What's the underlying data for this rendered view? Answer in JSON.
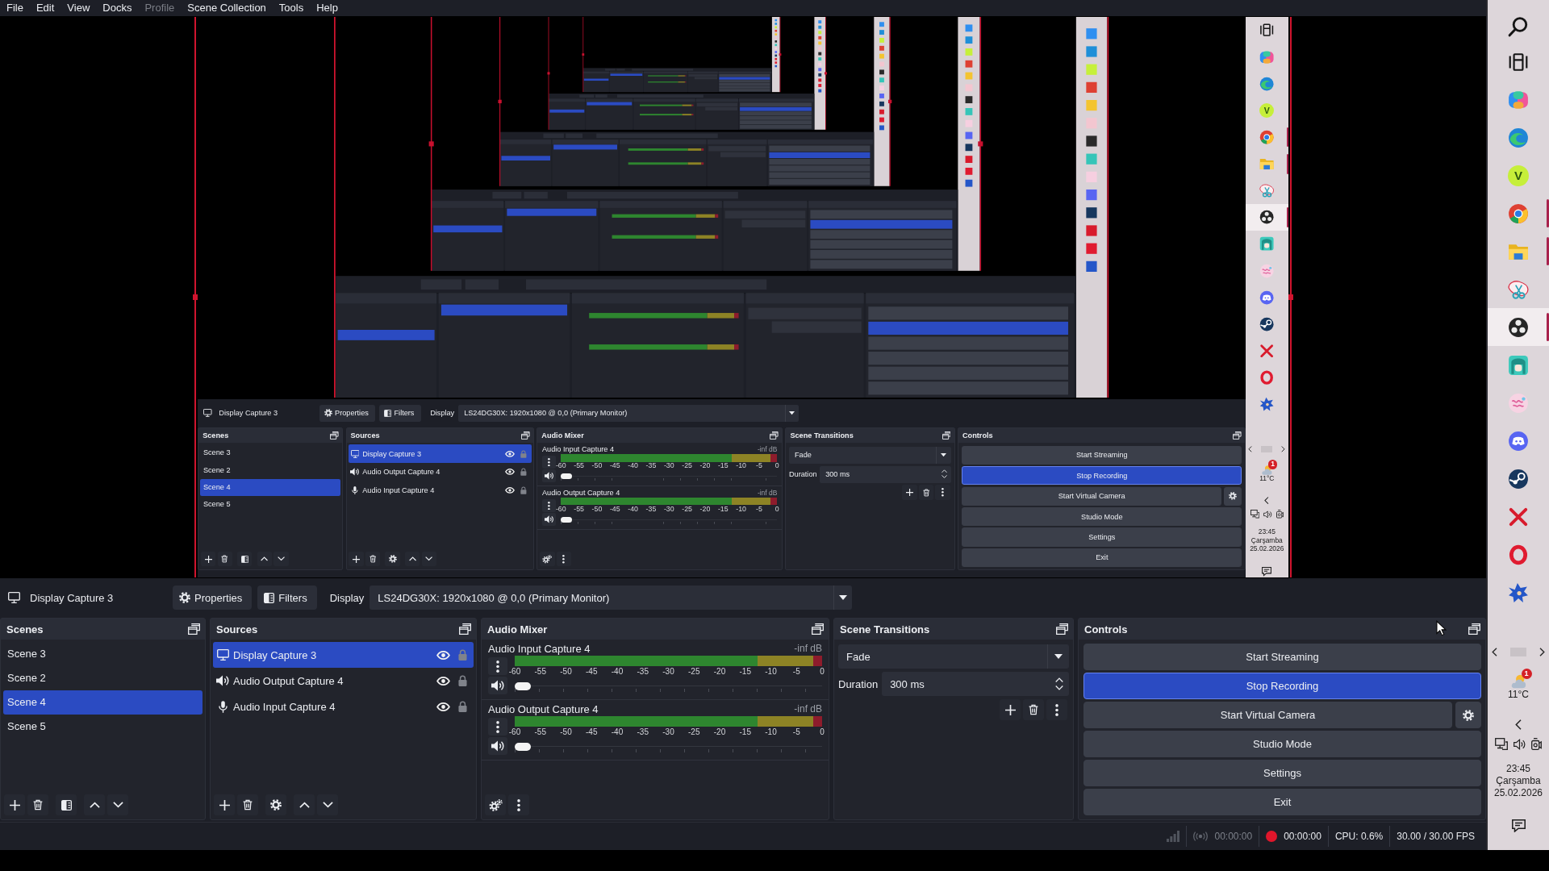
{
  "menu_bar": [
    {
      "label": "File",
      "disabled": false
    },
    {
      "label": "Edit",
      "disabled": false
    },
    {
      "label": "View",
      "disabled": false
    },
    {
      "label": "Docks",
      "disabled": false
    },
    {
      "label": "Profile",
      "disabled": true
    },
    {
      "label": "Scene Collection",
      "disabled": false
    },
    {
      "label": "Tools",
      "disabled": false
    },
    {
      "label": "Help",
      "disabled": false
    }
  ],
  "preview": {
    "capture": {
      "source_bar": {
        "source_name": "Display Capture 3",
        "properties": "Properties",
        "filters": "Filters",
        "display_label": "Display",
        "display_value": "LS24DG30X: 1920x1080 @ 0,0 (Primary Monitor)"
      },
      "docks": {
        "scenes": {
          "title": "Scenes",
          "items": [
            {
              "label": "Scene 3",
              "selected": false
            },
            {
              "label": "Scene 2",
              "selected": false
            },
            {
              "label": "Scene 4",
              "selected": true
            },
            {
              "label": "Scene 5",
              "selected": false
            }
          ]
        },
        "sources": {
          "title": "Sources",
          "items": [
            {
              "label": "Display Capture 3",
              "kind": "display",
              "selected": true,
              "visible": true,
              "locked": false
            },
            {
              "label": "Audio Output Capture 4",
              "kind": "speaker",
              "selected": false,
              "visible": true,
              "locked": false
            },
            {
              "label": "Audio Input Capture 4",
              "kind": "microphone",
              "selected": false,
              "visible": true,
              "locked": false
            }
          ]
        },
        "audio_mixer": {
          "title": "Audio Mixer",
          "channels": [
            {
              "name": "Audio Input Capture 4",
              "reading": "-inf dB",
              "muted": false,
              "volume": {
                "level": 0
              },
              "scale": [
                "-60",
                "-55",
                "-50",
                "-45",
                "-40",
                "-35",
                "-30",
                "-25",
                "-20",
                "-15",
                "-10",
                "-5",
                "0"
              ]
            },
            {
              "name": "Audio Output Capture 4",
              "reading": "-inf dB",
              "muted": false,
              "volume": {
                "level": 0
              },
              "scale": [
                "-60",
                "-55",
                "-50",
                "-45",
                "-40",
                "-35",
                "-30",
                "-25",
                "-20",
                "-15",
                "-10",
                "-5",
                "0"
              ]
            }
          ]
        },
        "scene_transitions": {
          "title": "Scene Transitions",
          "transition": "Fade",
          "duration_label": "Duration",
          "duration": "300 ms"
        },
        "controls": {
          "title": "Controls",
          "buttons": [
            {
              "label": "Start Streaming",
              "kind": "plain",
              "checked": false
            },
            {
              "label": "Stop Recording",
              "kind": "plain",
              "checked": true
            },
            {
              "label": "Start Virtual Camera",
              "kind": "split",
              "checked": false
            },
            {
              "label": "Studio Mode",
              "kind": "plain",
              "checked": false
            },
            {
              "label": "Settings",
              "kind": "plain",
              "checked": false
            },
            {
              "label": "Exit",
              "kind": "plain",
              "checked": false
            }
          ]
        }
      },
      "taskbar": {
        "apps": [
          {
            "kind": "taskview",
            "running": false,
            "selected": false
          },
          {
            "kind": "swirl",
            "running": false,
            "selected": false
          },
          {
            "kind": "wave",
            "running": false,
            "selected": false
          },
          {
            "kind": "letter",
            "glyph": "V",
            "running": false,
            "selected": false
          },
          {
            "kind": "wheel",
            "running": true,
            "selected": false
          },
          {
            "kind": "folder",
            "running": true,
            "selected": false
          },
          {
            "kind": "scissors",
            "running": false,
            "selected": false
          },
          {
            "kind": "reel",
            "running": true,
            "selected": true
          },
          {
            "kind": "character",
            "running": false,
            "selected": false
          },
          {
            "kind": "sticker",
            "running": false,
            "selected": false
          },
          {
            "kind": "controller",
            "running": false,
            "selected": false
          },
          {
            "kind": "piston",
            "running": false,
            "selected": false
          },
          {
            "kind": "cross",
            "running": false,
            "selected": false
          },
          {
            "kind": "ring",
            "running": false,
            "selected": false
          },
          {
            "kind": "figure",
            "running": false,
            "selected": false
          }
        ],
        "weather": {
          "badge": "1",
          "temperature": "11°C"
        },
        "clock": {
          "time": "23:45",
          "day": "Çarşamba",
          "date": "25.02.2026"
        }
      }
    }
  },
  "source_bar": {
    "source_name": "Display Capture 3",
    "properties": "Properties",
    "filters": "Filters",
    "display_label": "Display",
    "display_value": "LS24DG30X: 1920x1080 @ 0,0 (Primary Monitor)"
  },
  "docks": {
    "scenes": {
      "title": "Scenes",
      "items": [
        {
          "label": "Scene 3",
          "selected": false
        },
        {
          "label": "Scene 2",
          "selected": false
        },
        {
          "label": "Scene 4",
          "selected": true
        },
        {
          "label": "Scene 5",
          "selected": false
        }
      ]
    },
    "sources": {
      "title": "Sources",
      "items": [
        {
          "label": "Display Capture 3",
          "kind": "display",
          "selected": true,
          "visible": true,
          "locked": false
        },
        {
          "label": "Audio Output Capture 4",
          "kind": "speaker",
          "selected": false,
          "visible": true,
          "locked": false
        },
        {
          "label": "Audio Input Capture 4",
          "kind": "microphone",
          "selected": false,
          "visible": true,
          "locked": false
        }
      ]
    },
    "audio_mixer": {
      "title": "Audio Mixer",
      "channels": [
        {
          "name": "Audio Input Capture 4",
          "reading": "-inf dB",
          "muted": false,
          "volume": {
            "level": 0
          },
          "scale": [
            "-60",
            "-55",
            "-50",
            "-45",
            "-40",
            "-35",
            "-30",
            "-25",
            "-20",
            "-15",
            "-10",
            "-5",
            "0"
          ]
        },
        {
          "name": "Audio Output Capture 4",
          "reading": "-inf dB",
          "muted": false,
          "volume": {
            "level": 0
          },
          "scale": [
            "-60",
            "-55",
            "-50",
            "-45",
            "-40",
            "-35",
            "-30",
            "-25",
            "-20",
            "-15",
            "-10",
            "-5",
            "0"
          ]
        }
      ]
    },
    "scene_transitions": {
      "title": "Scene Transitions",
      "transition": "Fade",
      "duration_label": "Duration",
      "duration": "300 ms"
    },
    "controls": {
      "title": "Controls",
      "buttons": [
        {
          "label": "Start Streaming",
          "kind": "plain",
          "checked": false
        },
        {
          "label": "Stop Recording",
          "kind": "plain",
          "checked": true
        },
        {
          "label": "Start Virtual Camera",
          "kind": "split",
          "checked": false
        },
        {
          "label": "Studio Mode",
          "kind": "plain",
          "checked": false
        },
        {
          "label": "Settings",
          "kind": "plain",
          "checked": false
        },
        {
          "label": "Exit",
          "kind": "plain",
          "checked": false
        }
      ]
    }
  },
  "status_bar": {
    "streaming": false,
    "stream_time": "00:00:00",
    "recording": true,
    "record_time": "00:00:00",
    "cpu": "CPU: 0.6%",
    "fps": "30.00 / 30.00 FPS"
  },
  "taskbar": {
    "apps": [
      {
        "kind": "search",
        "running": false,
        "selected": false
      },
      {
        "kind": "taskview",
        "running": false,
        "selected": false
      },
      {
        "kind": "swirl",
        "running": false,
        "selected": false
      },
      {
        "kind": "wave",
        "running": false,
        "selected": false
      },
      {
        "kind": "letter",
        "glyph": "V",
        "running": false,
        "selected": false
      },
      {
        "kind": "wheel",
        "running": true,
        "selected": false
      },
      {
        "kind": "folder",
        "running": true,
        "selected": false
      },
      {
        "kind": "scissors",
        "running": false,
        "selected": false
      },
      {
        "kind": "reel",
        "running": true,
        "selected": true
      },
      {
        "kind": "character",
        "running": false,
        "selected": false
      },
      {
        "kind": "sticker",
        "running": false,
        "selected": false
      },
      {
        "kind": "controller",
        "running": false,
        "selected": false
      },
      {
        "kind": "piston",
        "running": false,
        "selected": false
      },
      {
        "kind": "cross",
        "running": false,
        "selected": false
      },
      {
        "kind": "ring",
        "running": false,
        "selected": false
      },
      {
        "kind": "figure",
        "running": false,
        "selected": false
      }
    ],
    "weather": {
      "badge": "1",
      "temperature": "11°C"
    },
    "clock": {
      "time": "23:45",
      "day": "Çarşamba",
      "date": "25.02.2026"
    }
  }
}
